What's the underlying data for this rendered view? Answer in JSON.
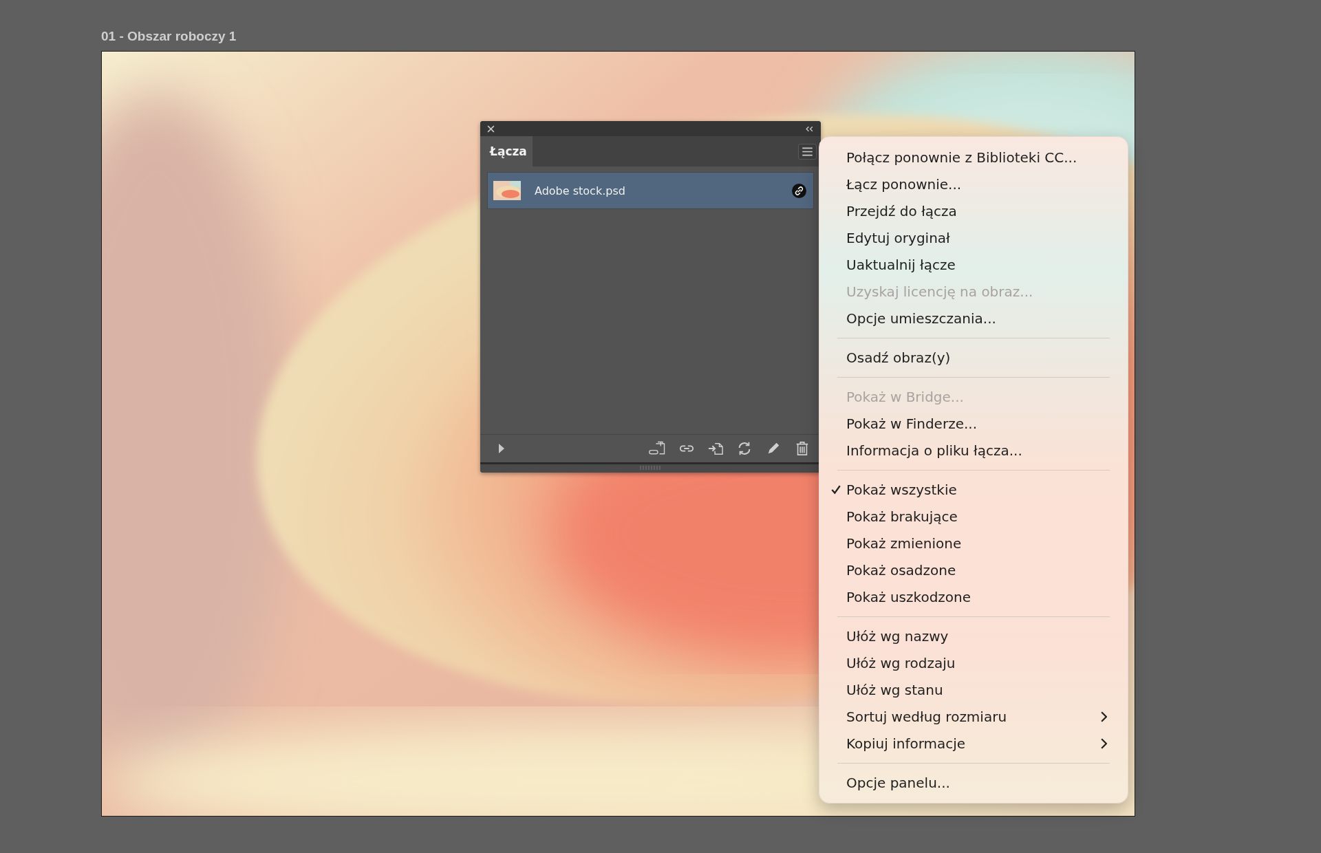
{
  "artboard": {
    "title": "01 - Obszar roboczy 1"
  },
  "panel": {
    "tab": {
      "label": "Łącza",
      "selected": true
    },
    "links": [
      {
        "name": "Adobe stock.psd",
        "selected": true
      }
    ]
  },
  "menu": {
    "items": [
      {
        "kind": "item",
        "label": "Połącz ponownie z Biblioteki CC...",
        "disabled": false,
        "checked": false,
        "submenu": false
      },
      {
        "kind": "item",
        "label": "Łącz ponownie...",
        "disabled": false,
        "checked": false,
        "submenu": false
      },
      {
        "kind": "item",
        "label": "Przejdź do łącza",
        "disabled": false,
        "checked": false,
        "submenu": false
      },
      {
        "kind": "item",
        "label": "Edytuj oryginał",
        "disabled": false,
        "checked": false,
        "submenu": false
      },
      {
        "kind": "item",
        "label": "Uaktualnij łącze",
        "disabled": false,
        "checked": false,
        "submenu": false
      },
      {
        "kind": "item",
        "label": "Uzyskaj licencję na obraz...",
        "disabled": true,
        "checked": false,
        "submenu": false
      },
      {
        "kind": "item",
        "label": "Opcje umieszczania...",
        "disabled": false,
        "checked": false,
        "submenu": false
      },
      {
        "kind": "separator"
      },
      {
        "kind": "item",
        "label": "Osadź obraz(y)",
        "disabled": false,
        "checked": false,
        "submenu": false
      },
      {
        "kind": "separator"
      },
      {
        "kind": "item",
        "label": "Pokaż w Bridge...",
        "disabled": true,
        "checked": false,
        "submenu": false
      },
      {
        "kind": "item",
        "label": "Pokaż w Finderze...",
        "disabled": false,
        "checked": false,
        "submenu": false
      },
      {
        "kind": "item",
        "label": "Informacja o pliku łącza...",
        "disabled": false,
        "checked": false,
        "submenu": false
      },
      {
        "kind": "separator"
      },
      {
        "kind": "item",
        "label": "Pokaż wszystkie",
        "disabled": false,
        "checked": true,
        "submenu": false
      },
      {
        "kind": "item",
        "label": "Pokaż brakujące",
        "disabled": false,
        "checked": false,
        "submenu": false
      },
      {
        "kind": "item",
        "label": "Pokaż zmienione",
        "disabled": false,
        "checked": false,
        "submenu": false
      },
      {
        "kind": "item",
        "label": "Pokaż osadzone",
        "disabled": false,
        "checked": false,
        "submenu": false
      },
      {
        "kind": "item",
        "label": "Pokaż uszkodzone",
        "disabled": false,
        "checked": false,
        "submenu": false
      },
      {
        "kind": "separator"
      },
      {
        "kind": "item",
        "label": "Ułóż wg nazwy",
        "disabled": false,
        "checked": false,
        "submenu": false
      },
      {
        "kind": "item",
        "label": "Ułóż wg rodzaju",
        "disabled": false,
        "checked": false,
        "submenu": false
      },
      {
        "kind": "item",
        "label": "Ułóż wg stanu",
        "disabled": false,
        "checked": false,
        "submenu": false
      },
      {
        "kind": "item",
        "label": "Sortuj według rozmiaru",
        "disabled": false,
        "checked": false,
        "submenu": true
      },
      {
        "kind": "item",
        "label": "Kopiuj informacje",
        "disabled": false,
        "checked": false,
        "submenu": true
      },
      {
        "kind": "separator"
      },
      {
        "kind": "item",
        "label": "Opcje panelu...",
        "disabled": false,
        "checked": false,
        "submenu": false
      }
    ]
  }
}
